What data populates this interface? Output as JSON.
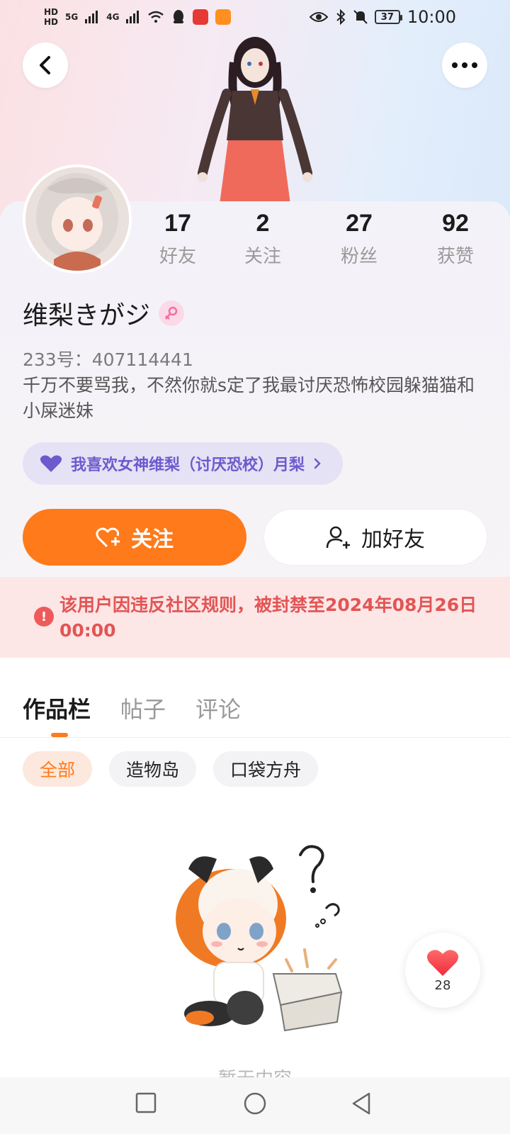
{
  "status_bar": {
    "time": "10:00",
    "battery": "37",
    "network_small_1": "HD",
    "network_small_2": "HD",
    "signal_1": "5G",
    "signal_2": "4G"
  },
  "nav": {
    "back_icon": "chevron-left-icon",
    "more_icon": "more-dots-icon"
  },
  "stats": [
    {
      "value": "17",
      "label": "好友"
    },
    {
      "value": "2",
      "label": "关注"
    },
    {
      "value": "27",
      "label": "粉丝"
    },
    {
      "value": "92",
      "label": "获赞"
    }
  ],
  "profile": {
    "name": "维梨きがジ",
    "gender_icon": "female-icon",
    "uid": "233号：407114441",
    "bio": "千万不要骂我，不然你就s定了我最讨厌恐怖校园躲猫猫和小屎迷妹",
    "tag": "我喜欢女神维梨（讨厌恐校）月梨"
  },
  "actions": {
    "follow_label": "关注",
    "add_friend_label": "加好友"
  },
  "ban_notice": "该用户因违反社区规则，被封禁至2024年08月26日 00:00",
  "tabs": [
    {
      "label": "作品栏",
      "active": true
    },
    {
      "label": "帖子",
      "active": false
    },
    {
      "label": "评论",
      "active": false
    }
  ],
  "filters": [
    {
      "label": "全部",
      "active": true
    },
    {
      "label": "造物岛",
      "active": false
    },
    {
      "label": "口袋方舟",
      "active": false
    }
  ],
  "empty_text": "暂无内容",
  "like_float": {
    "count": "28"
  },
  "colors": {
    "accent": "#ff7a1a",
    "ban_text": "#e25555",
    "tag_text": "#6b5bcc"
  }
}
